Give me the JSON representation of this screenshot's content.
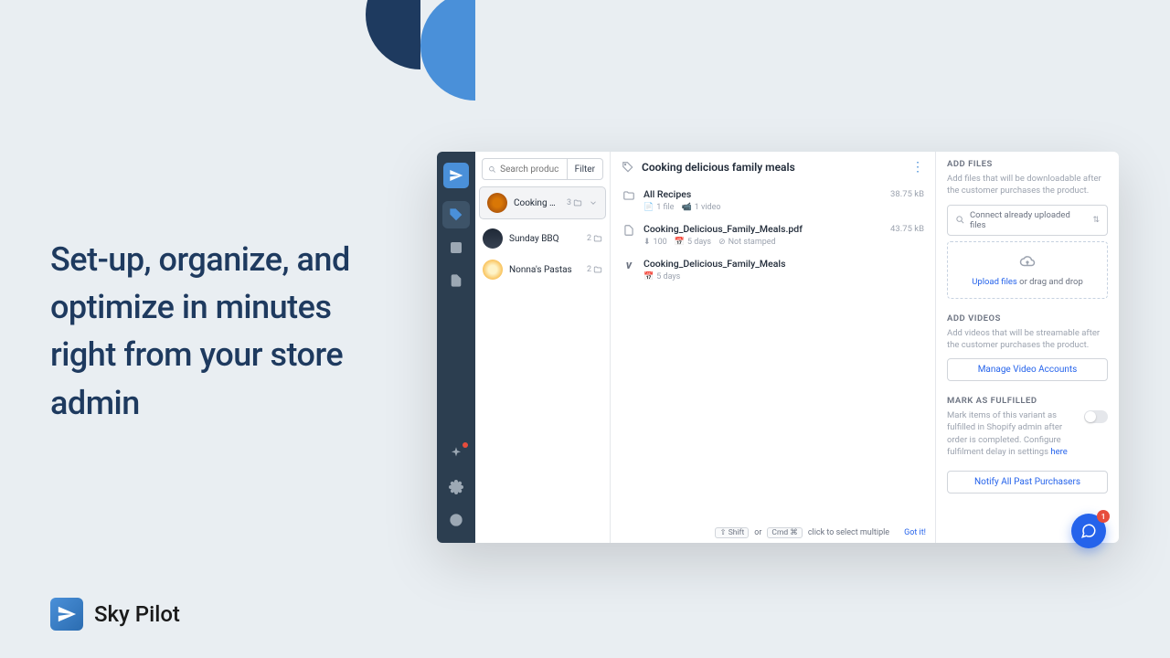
{
  "headline": "Set-up, organize, and optimize in minutes right from your store admin",
  "brand_name": "Sky Pilot",
  "search_placeholder": "Search produc",
  "filter_label": "Filter",
  "products": [
    {
      "name": "Cooking delicious f...",
      "count": "3"
    },
    {
      "name": "Sunday BBQ",
      "count": "2"
    },
    {
      "name": "Nonna's Pastas",
      "count": "2"
    }
  ],
  "detail_title": "Cooking delicious family meals",
  "files": [
    {
      "title": "All Recipes",
      "meta1": "1 file",
      "meta2": "1 video",
      "size": "38.75 kB",
      "icon": "folder"
    },
    {
      "title": "Cooking_Delicious_Family_Meals.pdf",
      "meta1": "100",
      "meta2": "5 days",
      "meta3": "Not stamped",
      "size": "43.75 kB",
      "icon": "file"
    },
    {
      "title": "Cooking_Delicious_Family_Meals",
      "meta1": "5 days",
      "icon": "vimeo"
    }
  ],
  "hint": {
    "shift": "Shift",
    "or": "or",
    "cmd": "Cmd ⌘",
    "text": "click to select multiple",
    "gotit": "Got it!",
    "arrow": "⇧"
  },
  "right": {
    "add_files_title": "ADD FILES",
    "add_files_desc": "Add files that will be downloadable after the customer purchases the product.",
    "connect_label": "Connect already uploaded files",
    "upload_link": "Upload files",
    "upload_rest": " or drag and drop",
    "add_videos_title": "ADD VIDEOS",
    "add_videos_desc": "Add videos that will be streamable after the customer purchases the product.",
    "manage_btn": "Manage Video Accounts",
    "mark_title": "MARK AS FULFILLED",
    "mark_desc": "Mark items of this variant as fulfilled in Shopify admin after order is completed. Configure fulfilment delay in settings ",
    "here": "here",
    "notify": "Notify All Past Purchasers"
  },
  "chat_badge": "1"
}
